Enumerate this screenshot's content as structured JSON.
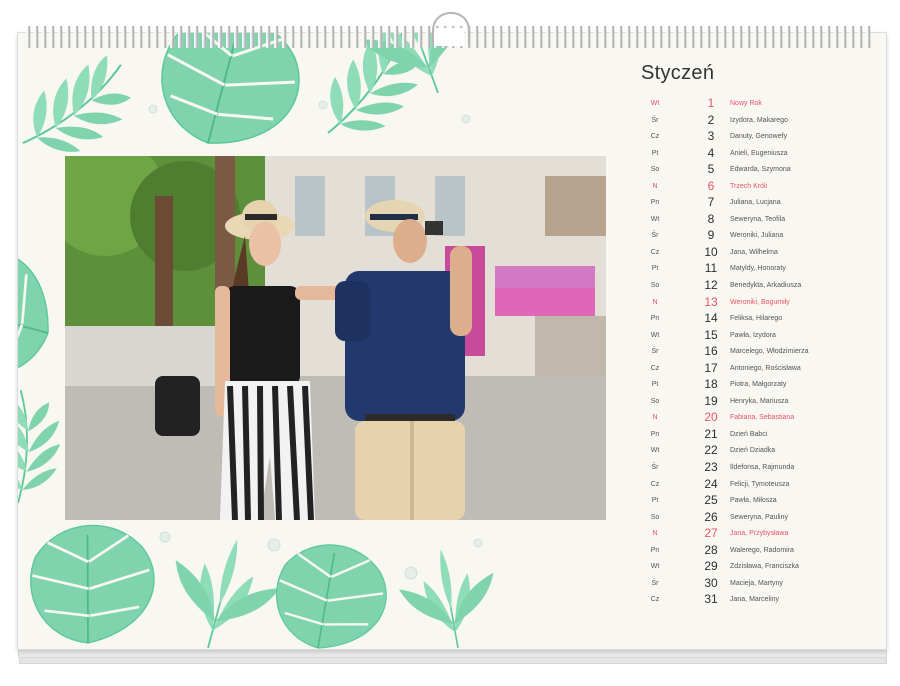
{
  "calendar": {
    "month": "Styczeń",
    "accent_color": "#e8556a",
    "days": [
      {
        "dow": "Wt",
        "num": "1",
        "names": "Nowy Rok",
        "holiday": true
      },
      {
        "dow": "Śr",
        "num": "2",
        "names": "Izydora, Makarego",
        "holiday": false
      },
      {
        "dow": "Cz",
        "num": "3",
        "names": "Danuty, Genowefy",
        "holiday": false
      },
      {
        "dow": "Pt",
        "num": "4",
        "names": "Anieli, Eugeniusza",
        "holiday": false
      },
      {
        "dow": "So",
        "num": "5",
        "names": "Edwarda, Szymona",
        "holiday": false
      },
      {
        "dow": "N",
        "num": "6",
        "names": "Trzech Króli",
        "holiday": true
      },
      {
        "dow": "Pn",
        "num": "7",
        "names": "Juliana, Lucjana",
        "holiday": false
      },
      {
        "dow": "Wt",
        "num": "8",
        "names": "Seweryna, Teofila",
        "holiday": false
      },
      {
        "dow": "Śr",
        "num": "9",
        "names": "Weroniki, Juliana",
        "holiday": false
      },
      {
        "dow": "Cz",
        "num": "10",
        "names": "Jana, Wilhelma",
        "holiday": false
      },
      {
        "dow": "Pt",
        "num": "11",
        "names": "Matyldy, Honoraty",
        "holiday": false
      },
      {
        "dow": "So",
        "num": "12",
        "names": "Benedykta, Arkadiusza",
        "holiday": false
      },
      {
        "dow": "N",
        "num": "13",
        "names": "Weroniki, Bogumiły",
        "holiday": true
      },
      {
        "dow": "Pn",
        "num": "14",
        "names": "Feliksa, Hilarego",
        "holiday": false
      },
      {
        "dow": "Wt",
        "num": "15",
        "names": "Pawła, Izydora",
        "holiday": false
      },
      {
        "dow": "Śr",
        "num": "16",
        "names": "Marcelego, Włodzimierza",
        "holiday": false
      },
      {
        "dow": "Cz",
        "num": "17",
        "names": "Antoniego, Rościsława",
        "holiday": false
      },
      {
        "dow": "Pt",
        "num": "18",
        "names": "Piotra, Małgorzaty",
        "holiday": false
      },
      {
        "dow": "So",
        "num": "19",
        "names": "Henryka, Mariusza",
        "holiday": false
      },
      {
        "dow": "N",
        "num": "20",
        "names": "Fabiana, Sebastiana",
        "holiday": true
      },
      {
        "dow": "Pn",
        "num": "21",
        "names": "Dzień Babci",
        "holiday": false
      },
      {
        "dow": "Wt",
        "num": "22",
        "names": "Dzień Dziadka",
        "holiday": false
      },
      {
        "dow": "Śr",
        "num": "23",
        "names": "Ildefonsa, Rajmunda",
        "holiday": false
      },
      {
        "dow": "Cz",
        "num": "24",
        "names": "Felicji, Tymoteusza",
        "holiday": false
      },
      {
        "dow": "Pt",
        "num": "25",
        "names": "Pawła, Miłosza",
        "holiday": false
      },
      {
        "dow": "So",
        "num": "26",
        "names": "Seweryna, Pauliny",
        "holiday": false
      },
      {
        "dow": "N",
        "num": "27",
        "names": "Jana, Przybysława",
        "holiday": true
      },
      {
        "dow": "Pn",
        "num": "28",
        "names": "Walerego, Radomira",
        "holiday": false
      },
      {
        "dow": "Wt",
        "num": "29",
        "names": "Zdzisława, Franciszka",
        "holiday": false
      },
      {
        "dow": "Śr",
        "num": "30",
        "names": "Macieja, Martyny",
        "holiday": false
      },
      {
        "dow": "Cz",
        "num": "31",
        "names": "Jana, Marceliny",
        "holiday": false
      }
    ]
  },
  "decor": {
    "leaf_color": "#7fd4ae",
    "leaf_dark": "#4fb98c"
  }
}
